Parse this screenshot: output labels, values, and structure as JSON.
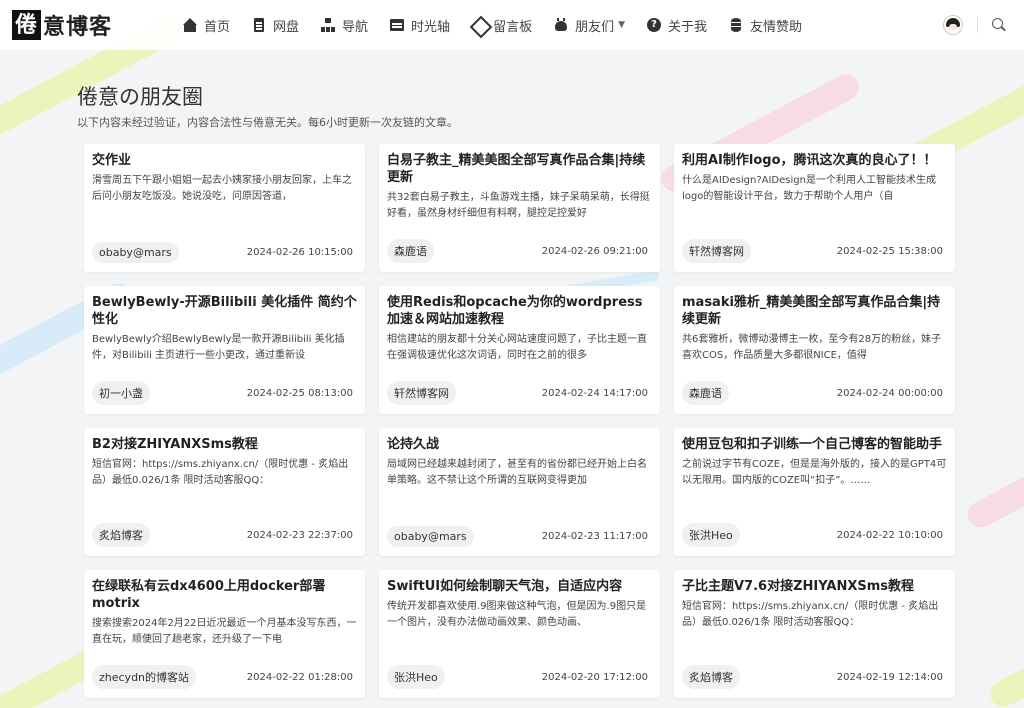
{
  "logo": {
    "first": "倦",
    "rest": "意博客"
  },
  "nav": [
    {
      "label": "首页",
      "icon": "home-icon"
    },
    {
      "label": "网盘",
      "icon": "file-icon"
    },
    {
      "label": "导航",
      "icon": "sitemap-icon"
    },
    {
      "label": "时光轴",
      "icon": "timeline-icon"
    },
    {
      "label": "留言板",
      "icon": "board-icon"
    },
    {
      "label": "朋友们",
      "icon": "friends-icon",
      "dropdown": true
    },
    {
      "label": "关于我",
      "icon": "about-icon"
    },
    {
      "label": "友情赞助",
      "icon": "database-icon"
    }
  ],
  "page": {
    "title": "倦意の朋友圈",
    "subtitle": "以下内容未经过验证，内容合法性与倦意无关。每6小时更新一次友链的文章。"
  },
  "cards": [
    {
      "title": "交作业",
      "desc": "滑雪周五下午跟小姐姐一起去小姨家接小朋友回家，上车之后问小朋友吃饭没。她说没吃，问原因答道，",
      "author": "obaby@mars",
      "date": "2024-02-26 10:15:00"
    },
    {
      "title": "白易子教主_精美美图全部写真作品合集|持续更新",
      "desc": "共32套白易子教主，斗鱼游戏主播，妹子呆萌呆萌，长得挺好看，虽然身材纤细但有料啊，腿控足控爱好",
      "author": "森鹿语",
      "date": "2024-02-26 09:21:00"
    },
    {
      "title": "利用AI制作logo，腾讯这次真的良心了！！",
      "desc": "什么是AIDesign?AIDesign是一个利用人工智能技术生成logo的智能设计平台，致力于帮助个人用户（自",
      "author": "轩然博客网",
      "date": "2024-02-25 15:38:00"
    },
    {
      "title": "BewlyBewly-开源Bilibili 美化插件 简约个性化",
      "desc": "BewlyBewly介绍BewlyBewly是一款开源Bilibili 美化插件，对Bilibili 主页进行一些小更改，通过重新设",
      "author": "初一小盏",
      "date": "2024-02-25 08:13:00"
    },
    {
      "title": "使用Redis和opcache为你的wordpress加速＆网站加速教程",
      "desc": "相信建站的朋友都十分关心网站速度问题了，子比主题一直在强调极速优化这次词语，同时在之前的很多",
      "author": "轩然博客网",
      "date": "2024-02-24 14:17:00"
    },
    {
      "title": "masaki雅析_精美美图全部写真作品合集|持续更新",
      "desc": "共6套雅析，微博动漫博主一枚，至今有28万的粉丝，妹子喜欢COS，作品质量大多都很NICE，值得",
      "author": "森鹿语",
      "date": "2024-02-24 00:00:00"
    },
    {
      "title": "B2对接ZHIYANXSms教程",
      "desc": "短信官网：https://sms.zhiyanx.cn/（限时优惠 - 炙焰出品）最低0.026/1条 限时活动客服QQ：",
      "author": "炙焰博客",
      "date": "2024-02-23 22:37:00"
    },
    {
      "title": "论持久战",
      "desc": "局域网已经越来越封闭了，甚至有的省份都已经开始上白名单策略。这不禁让这个所谓的互联网变得更加",
      "author": "obaby@mars",
      "date": "2024-02-23 11:17:00"
    },
    {
      "title": "使用豆包和扣子训练一个自己博客的智能助手",
      "desc": "之前说过字节有COZE，但是是海外版的，接入的是GPT4可以无限用。国内版的COZE叫“扣子”。……",
      "author": "张洪Heo",
      "date": "2024-02-22 10:10:00"
    },
    {
      "title": "在绿联私有云dx4600上用docker部署motrix",
      "desc": "搜索搜索2024年2月22日近况最近一个月基本没写东西，一直在玩，顺便回了趟老家，还升级了一下电",
      "author": "zhecydn的博客站",
      "date": "2024-02-22 01:28:00"
    },
    {
      "title": "SwiftUI如何绘制聊天气泡，自适应内容",
      "desc": "传统开发都喜欢使用.9图来做这种气泡，但是因为.9图只是一个图片，没有办法做动画效果、颜色动画、",
      "author": "张洪Heo",
      "date": "2024-02-20 17:12:00"
    },
    {
      "title": "子比主题V7.6对接ZHIYANXSms教程",
      "desc": "短信官网：https://sms.zhiyanx.cn/（限时优惠 - 炙焰出品）最低0.026/1条 限时活动客服QQ：",
      "author": "炙焰博客",
      "date": "2024-02-19 12:14:00"
    }
  ]
}
